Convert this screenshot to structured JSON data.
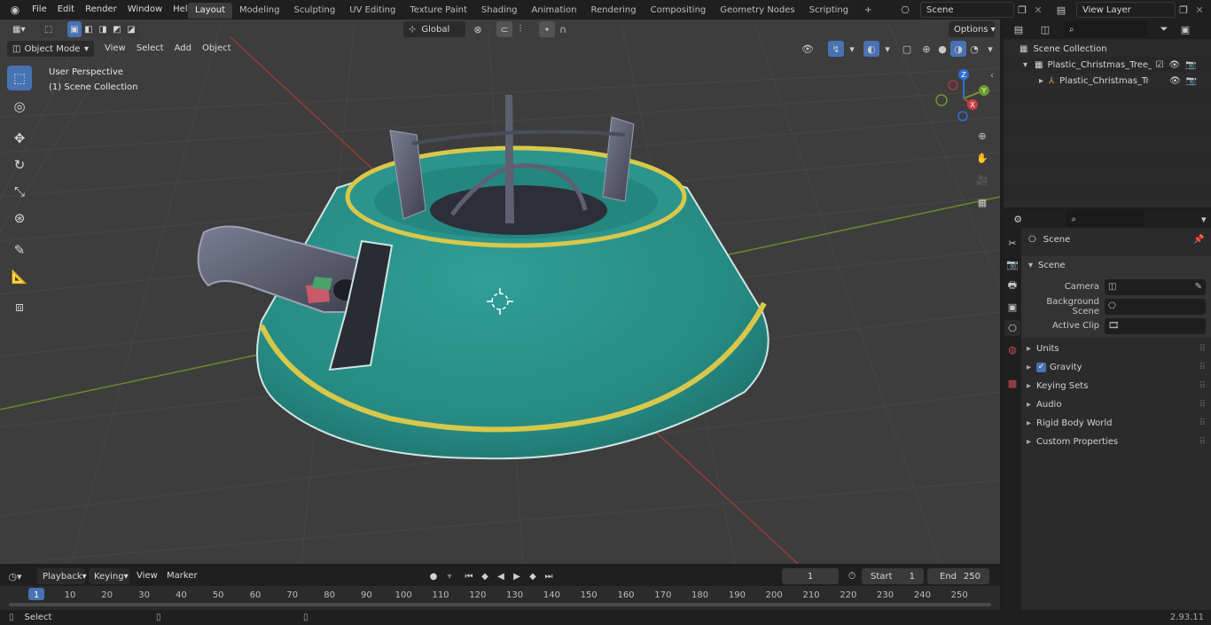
{
  "topbar": {
    "menus": [
      "File",
      "Edit",
      "Render",
      "Window",
      "Help"
    ],
    "workspaces": [
      "Layout",
      "Modeling",
      "Sculpting",
      "UV Editing",
      "Texture Paint",
      "Shading",
      "Animation",
      "Rendering",
      "Compositing",
      "Geometry Nodes",
      "Scripting"
    ],
    "active_workspace": "Layout",
    "add_workspace": "+",
    "scene_name": "Scene",
    "view_layer": "View Layer"
  },
  "viewport_header": {
    "mode": "Object Mode",
    "menus": [
      "View",
      "Select",
      "Add",
      "Object"
    ],
    "transform_orientation": "Global",
    "options_label": "Options"
  },
  "viewport": {
    "overlay_title": "User Perspective",
    "overlay_collection": "(1) Scene Collection",
    "gizmo": {
      "z": "Z",
      "y": "Y",
      "x": "X"
    },
    "colors": {
      "stand_body": "#2b9a93",
      "stripe": "#d8c84a",
      "metal": "#56586a",
      "grid_bg": "#3d3d3d"
    }
  },
  "outliner": {
    "root": "Scene Collection",
    "items": [
      {
        "label": "Plastic_Christmas_Tree_Stanc"
      },
      {
        "label": "Plastic_Christmas_Tree_S"
      }
    ]
  },
  "properties": {
    "breadcrumb": "Scene",
    "section": "Scene",
    "fields": [
      {
        "label": "Camera",
        "value": ""
      },
      {
        "label": "Background Scene",
        "value": ""
      },
      {
        "label": "Active Clip",
        "value": ""
      }
    ],
    "panels": [
      "Units",
      "Gravity",
      "Keying Sets",
      "Audio",
      "Rigid Body World",
      "Custom Properties"
    ],
    "gravity_checked": true
  },
  "timeline": {
    "menus": [
      "Playback",
      "Keying",
      "View",
      "Marker"
    ],
    "current_frame": "1",
    "start_label": "Start",
    "start": "1",
    "end_label": "End",
    "end": "250",
    "ticks": [
      "1",
      "10",
      "20",
      "30",
      "40",
      "50",
      "60",
      "70",
      "80",
      "90",
      "100",
      "110",
      "120",
      "130",
      "140",
      "150",
      "160",
      "170",
      "180",
      "190",
      "200",
      "210",
      "220",
      "230",
      "240",
      "250"
    ]
  },
  "statusbar": {
    "left": "Select",
    "version": "2.93.11"
  }
}
